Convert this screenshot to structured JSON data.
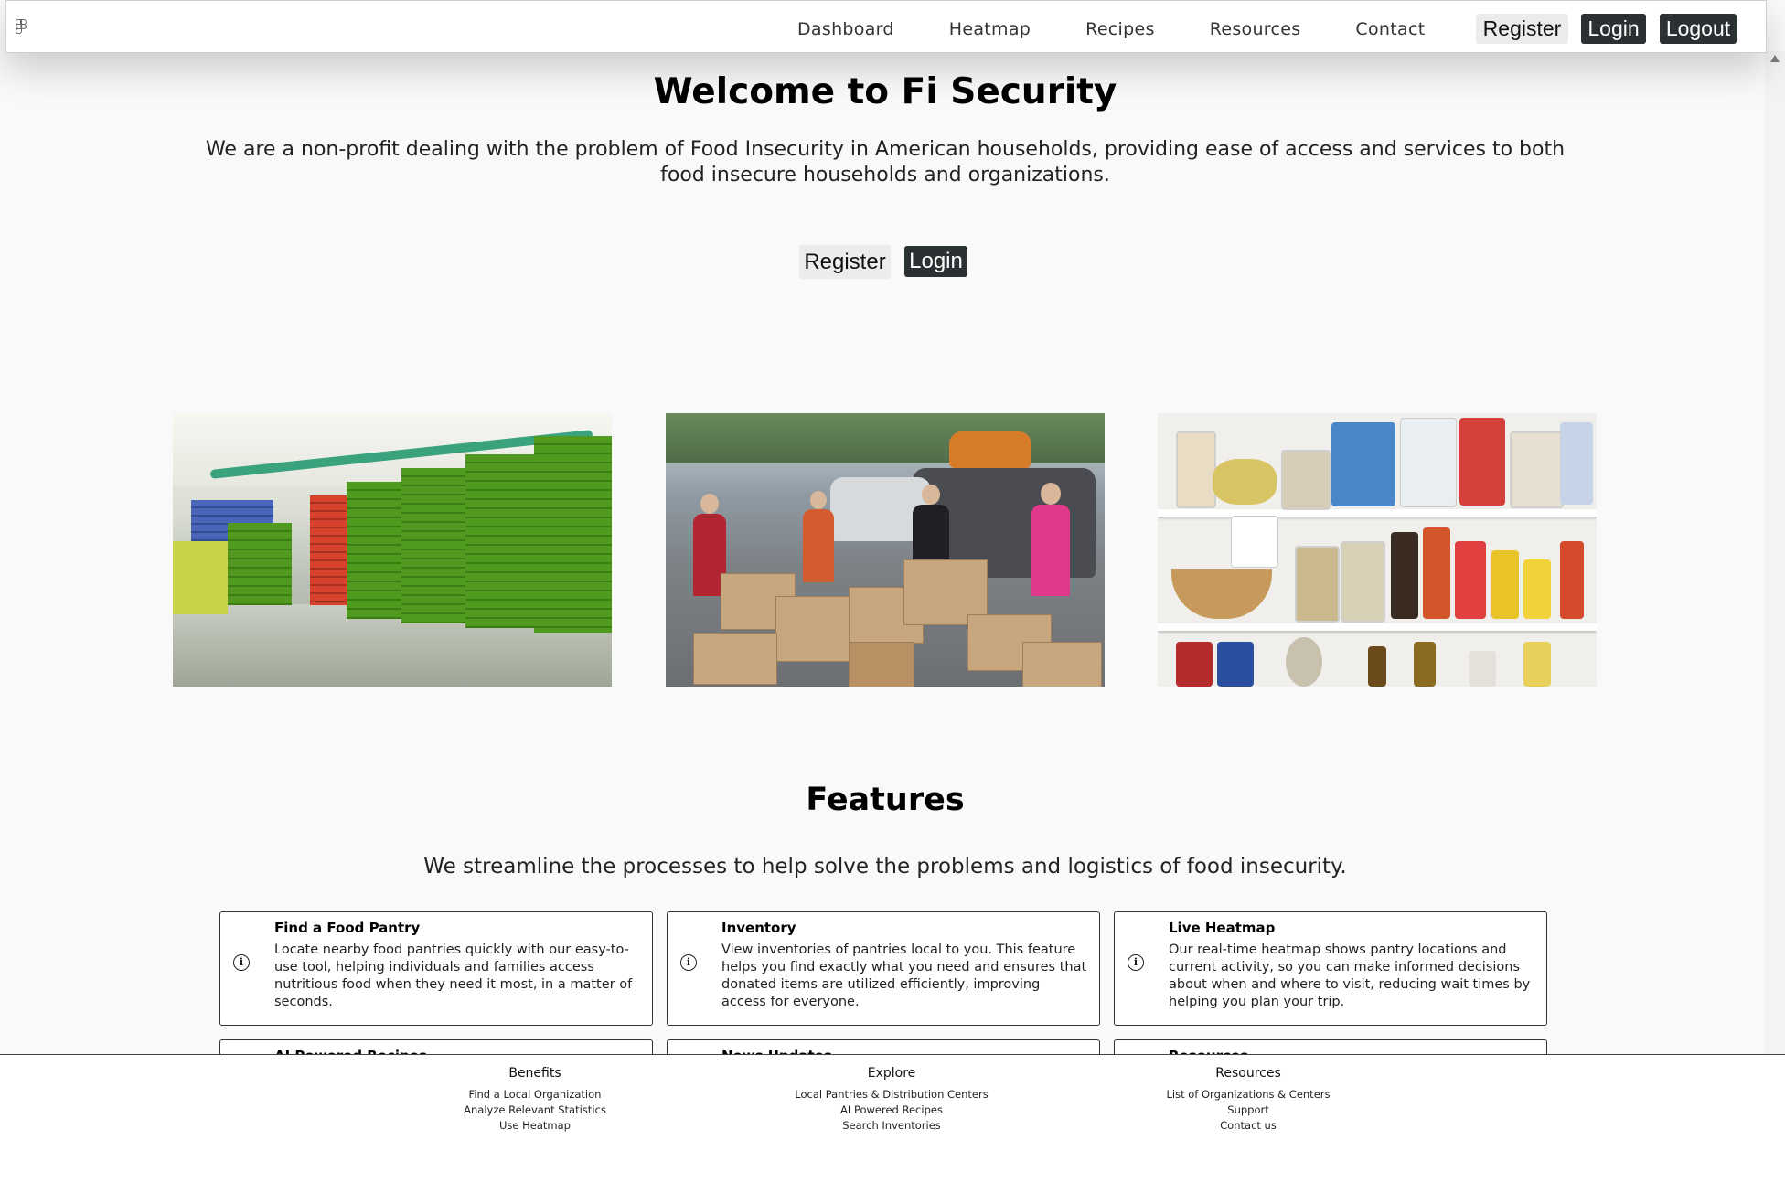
{
  "nav": {
    "links": [
      "Dashboard",
      "Heatmap",
      "Recipes",
      "Resources",
      "Contact"
    ],
    "register": "Register",
    "login": "Login",
    "logout": "Logout"
  },
  "hero": {
    "title": "Welcome to Fi Security",
    "subtitle": "We are a non-profit dealing with the problem of Food Insecurity in American households, providing ease of access and services to both food insecure households and organizations.",
    "register": "Register",
    "login": "Login"
  },
  "features": {
    "title": "Features",
    "subtitle": "We streamline the processes to help solve the problems and logistics of food insecurity.",
    "cards": [
      {
        "title": "Find a Food Pantry",
        "body": "Locate nearby food pantries quickly with our easy-to-use tool, helping individuals and families access nutritious food when they need it most, in a matter of seconds."
      },
      {
        "title": "Inventory",
        "body": "View inventories of pantries local to you. This feature helps you find exactly what you need and ensures that donated items are utilized efficiently, improving access for everyone."
      },
      {
        "title": "Live Heatmap",
        "body": "Our real-time heatmap shows pantry locations and current activity, so you can make informed decisions about when and where to visit, reducing wait times by helping you plan your trip."
      },
      {
        "title": "AI Powered Recipes",
        "body": ""
      },
      {
        "title": "News Updates",
        "body": ""
      },
      {
        "title": "Resources",
        "body": ""
      }
    ]
  },
  "footer": {
    "columns": [
      {
        "heading": "Benefits",
        "links": [
          "Find a Local Organization",
          "Analyze Relevant Statistics",
          "Use Heatmap"
        ]
      },
      {
        "heading": "Explore",
        "links": [
          "Local Pantries & Distribution Centers",
          "AI Powered Recipes",
          "Search Inventories"
        ]
      },
      {
        "heading": "Resources",
        "links": [
          "List of Organizations & Centers",
          "Support",
          "Contact us"
        ]
      }
    ]
  },
  "icons": {
    "logo": "figma-logo-icon",
    "card_icon": "info-icon",
    "scroll": "scroll-up-arrow-icon"
  },
  "colors": {
    "dark_button": "#2b3132",
    "light_button": "#ececec",
    "background": "#f9f9f9"
  }
}
